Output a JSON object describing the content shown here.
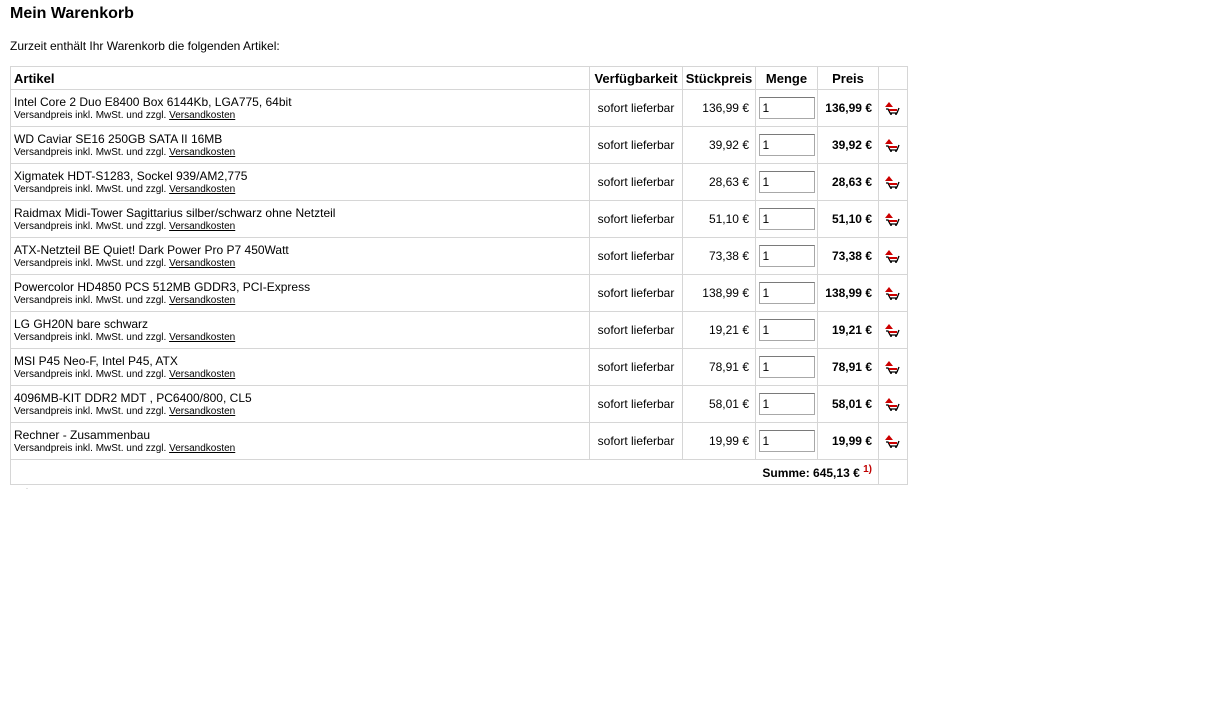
{
  "page": {
    "title": "Mein Warenkorb",
    "intro": "Zurzeit enthält Ihr Warenkorb die folgenden Artikel:"
  },
  "table": {
    "headers": {
      "artikel": "Artikel",
      "availability": "Verfügbarkeit",
      "unit_price": "Stückpreis",
      "quantity": "Menge",
      "price": "Preis"
    },
    "shipping_note": "Versandpreis inkl. MwSt. und zzgl.",
    "shipping_link": "Versandkosten",
    "items": [
      {
        "name": "Intel Core 2 Duo E8400 Box 6144Kb, LGA775, 64bit",
        "availability": "sofort lieferbar",
        "unit_price": "136,99 €",
        "quantity": "1",
        "price": "136,99 €"
      },
      {
        "name": "WD Caviar SE16 250GB SATA II 16MB",
        "availability": "sofort lieferbar",
        "unit_price": "39,92 €",
        "quantity": "1",
        "price": "39,92 €"
      },
      {
        "name": "Xigmatek HDT-S1283, Sockel 939/AM2,775",
        "availability": "sofort lieferbar",
        "unit_price": "28,63 €",
        "quantity": "1",
        "price": "28,63 €"
      },
      {
        "name": "Raidmax Midi-Tower Sagittarius silber/schwarz ohne Netzteil",
        "availability": "sofort lieferbar",
        "unit_price": "51,10 €",
        "quantity": "1",
        "price": "51,10 €"
      },
      {
        "name": "ATX-Netzteil BE Quiet! Dark Power Pro P7 450Watt",
        "availability": "sofort lieferbar",
        "unit_price": "73,38 €",
        "quantity": "1",
        "price": "73,38 €"
      },
      {
        "name": "Powercolor HD4850 PCS 512MB GDDR3, PCI-Express",
        "availability": "sofort lieferbar",
        "unit_price": "138,99 €",
        "quantity": "1",
        "price": "138,99 €"
      },
      {
        "name": "LG GH20N bare schwarz",
        "availability": "sofort lieferbar",
        "unit_price": "19,21 €",
        "quantity": "1",
        "price": "19,21 €"
      },
      {
        "name": "MSI P45 Neo-F, Intel P45, ATX",
        "availability": "sofort lieferbar",
        "unit_price": "78,91 €",
        "quantity": "1",
        "price": "78,91 €"
      },
      {
        "name": "4096MB-KIT DDR2 MDT , PC6400/800, CL5",
        "availability": "sofort lieferbar",
        "unit_price": "58,01 €",
        "quantity": "1",
        "price": "58,01 €"
      },
      {
        "name": "Rechner - Zusammenbau",
        "availability": "sofort lieferbar",
        "unit_price": "19,99 €",
        "quantity": "1",
        "price": "19,99 €"
      }
    ],
    "delete_icon": "remove-from-cart-icon",
    "total_label": "Summe: 645,13 €",
    "total_footnote": "1)"
  },
  "colors": {
    "border": "#d6d6d6",
    "icon_red": "#cc0000",
    "footnote_red": "#c00000"
  }
}
